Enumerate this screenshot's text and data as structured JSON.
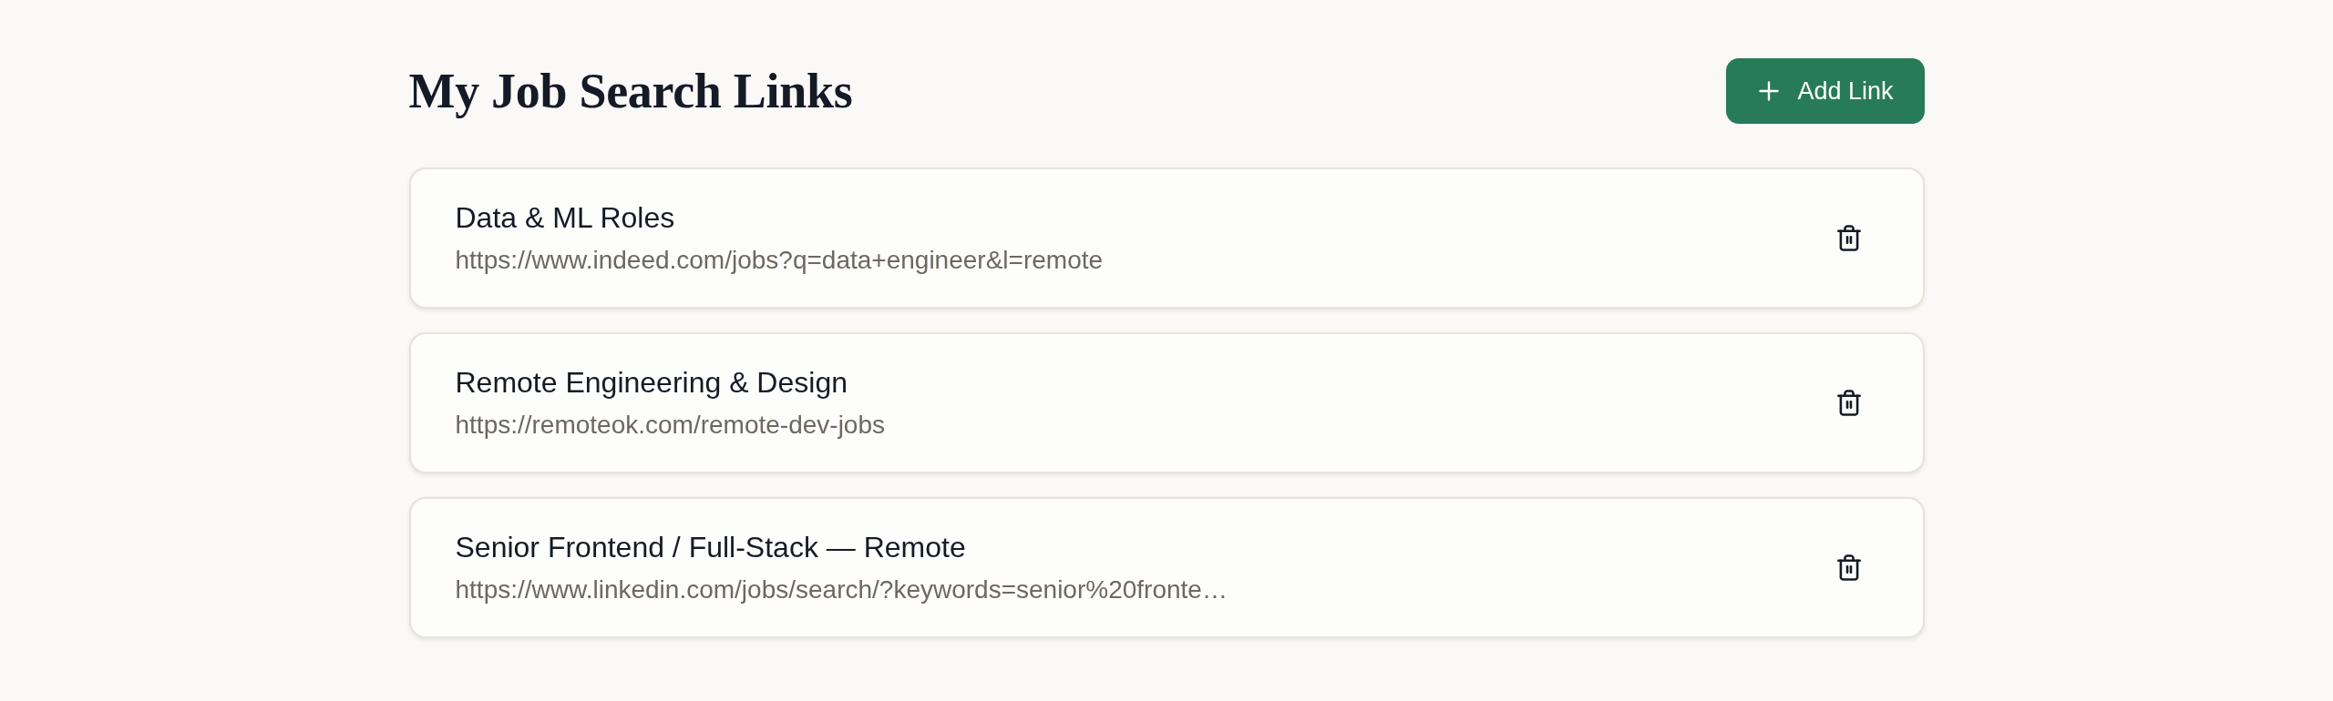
{
  "header": {
    "title": "My Job Search Links",
    "add_button": {
      "label": "Add Link"
    }
  },
  "links": [
    {
      "name": "Data & ML Roles",
      "url": "https://www.indeed.com/jobs?q=data+engineer&l=remote"
    },
    {
      "name": "Remote Engineering & Design",
      "url": "https://remoteok.com/remote-dev-jobs"
    },
    {
      "name": "Senior Frontend / Full-Stack — Remote",
      "url": "https://www.linkedin.com/jobs/search/?keywords=senior%20fronte…"
    }
  ]
}
